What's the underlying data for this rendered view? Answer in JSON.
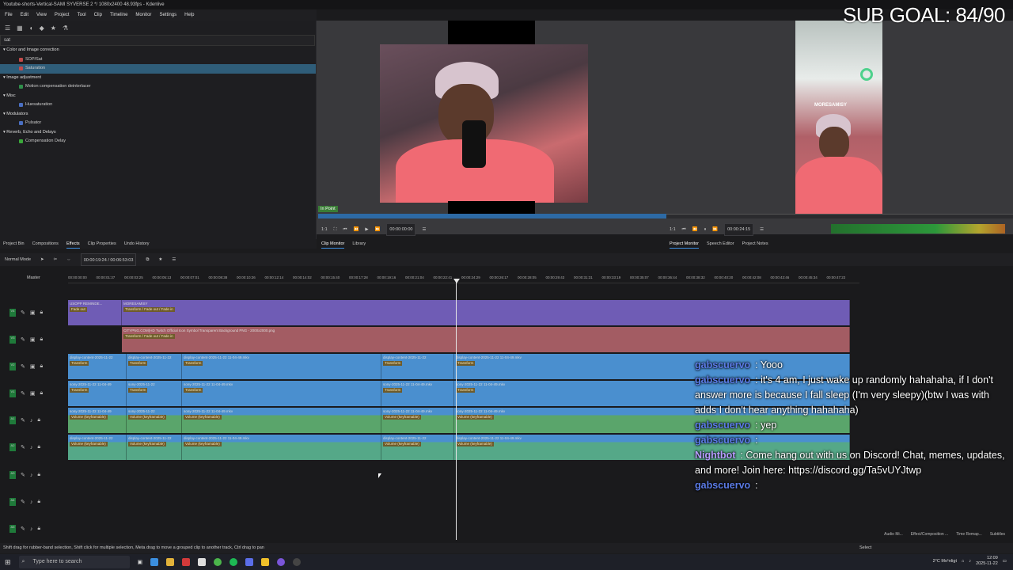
{
  "window": {
    "title": "Youtube-shorts-Vertical-SAMI SYVERSE 2 */ 1080x2400 48.93fps - Kdenlive"
  },
  "menu": [
    "File",
    "Edit",
    "View",
    "Project",
    "Tool",
    "Clip",
    "Timeline",
    "Monitor",
    "Settings",
    "Help"
  ],
  "effects": {
    "search_value": "sat",
    "tree": [
      {
        "kind": "cat",
        "label": "Color and Image correction"
      },
      {
        "kind": "item",
        "label": "SOP/Sat",
        "color": "#c24a4a",
        "selected": false
      },
      {
        "kind": "item",
        "label": "Saturation",
        "color": "#c24a4a",
        "selected": true
      },
      {
        "kind": "cat",
        "label": "Image adjustment"
      },
      {
        "kind": "item",
        "label": "Motion compensation deinterlacer",
        "color": "#2f8f4a",
        "selected": false
      },
      {
        "kind": "cat",
        "label": "Misc"
      },
      {
        "kind": "item",
        "label": "Huesaturation",
        "color": "#4a6fc2",
        "selected": false
      },
      {
        "kind": "cat",
        "label": "Modulators"
      },
      {
        "kind": "item",
        "label": "Pulsator",
        "color": "#4a6fc2",
        "selected": false
      },
      {
        "kind": "cat",
        "label": "Reverb, Echo and Delays"
      },
      {
        "kind": "item",
        "label": "Compensation Delay",
        "color": "#3aa83a",
        "selected": false
      }
    ]
  },
  "overlay": {
    "sub_goal": "SUB GOAL: 84/90"
  },
  "clip_monitor": {
    "in_point": "In Point",
    "zoom": "1:1",
    "timecode": "00:00:00:00"
  },
  "project_monitor": {
    "zoom": "1:1",
    "timecode": "00:00:24:15",
    "watermark": "MORESAMISY"
  },
  "tabs": {
    "left": [
      "Project Bin",
      "Compositions",
      "Effects",
      "Clip Properties",
      "Undo History"
    ],
    "left_active": "Effects",
    "clip": [
      "Clip Monitor",
      "Library"
    ],
    "clip_active": "Clip Monitor",
    "project": [
      "Project Monitor",
      "Speech Editor",
      "Project Notes"
    ],
    "project_active": "Project Monitor"
  },
  "timeline": {
    "mode": "Normal Mode",
    "position": "00:00:19:24 / 00:06:53:03",
    "master": "Master",
    "ruler": [
      "00:00:00:00",
      "00:00:01:37",
      "00:00:03:25",
      "00:00:05:13",
      "00:00:07:01",
      "00:00:08:38",
      "00:00:10:26",
      "00:00:12:14",
      "00:00:14:02",
      "00:00:15:40",
      "00:00:17:28",
      "00:00:19:16",
      "00:00:21:04",
      "00:00:22:41",
      "00:00:24:29",
      "00:00:26:17",
      "00:00:28:05",
      "00:00:29:43",
      "00:00:31:31",
      "00:00:33:19",
      "00:00:35:07",
      "00:00:36:44",
      "00:00:38:32",
      "00:00:40:20",
      "00:00:42:08",
      "00:00:43:46",
      "00:00:45:34",
      "00:00:47:22"
    ],
    "tracks": [
      {
        "id": "V4",
        "clips": [
          {
            "style": "purple",
            "title": "USOPP REMINDE...",
            "effect": "Fade out"
          },
          {
            "style": "purple",
            "title": "MORESAMISY",
            "effect": "Transform / Fade out / Fade in"
          }
        ]
      },
      {
        "id": "V3",
        "clips": [
          {
            "style": "pink",
            "title": "CITYPNG.COM)HD Twitch Official Icon Symbol Transparent Background PNG - 2000x2000.png",
            "effect": "Transform / Fade out / Fade in"
          }
        ]
      },
      {
        "id": "V2",
        "clips": [
          {
            "style": "blue",
            "title": "display-content-2025-11-22",
            "effect": "Transform"
          },
          {
            "style": "blue",
            "title": "display-content-2025-11-22",
            "effect": "Transform"
          },
          {
            "style": "blue",
            "title": "display-content-2025-11-22 11-04-49.mkv",
            "effect": "Transform"
          },
          {
            "style": "blue",
            "title": "display-content-2025-11-22",
            "effect": "Transform"
          },
          {
            "style": "blue",
            "title": "display-content-2025-11-22 11-04-49.mkv",
            "effect": "Transform"
          }
        ]
      },
      {
        "id": "V1",
        "clips": [
          {
            "style": "blue",
            "title": "sony-2025-11-22 11-04-49",
            "effect": "Transform"
          },
          {
            "style": "blue",
            "title": "sony-2025-11-22",
            "effect": "Transform"
          },
          {
            "style": "blue",
            "title": "sony-2025-11-22 11-04-49.mkv",
            "effect": "Transform"
          },
          {
            "style": "blue",
            "title": "sony-2025-11-22 11-04-49.mkv",
            "effect": "Transform"
          },
          {
            "style": "blue",
            "title": "sony-2025-11-22 11-04-49.mkv",
            "effect": "Transform"
          }
        ]
      },
      {
        "id": "A1",
        "clips": [
          {
            "style": "green",
            "title": "sony-2025-11-22 11-04-49",
            "effect": "Volume (keyframable)"
          },
          {
            "style": "green",
            "title": "sony-2025-11-22",
            "effect": "Volume (keyframable)"
          },
          {
            "style": "green",
            "title": "sony-2025-11-22 11-04-49.mkv",
            "effect": "Volume (keyframable)"
          },
          {
            "style": "green",
            "title": "sony-2025-11-22 11-04-49.mkv",
            "effect": "Volume (keyframable)"
          },
          {
            "style": "green",
            "title": "sony-2025-11-22 11-04-49.mkv",
            "effect": "Volume (keyframable)"
          }
        ]
      },
      {
        "id": "A2",
        "clips": [
          {
            "style": "teal",
            "title": "display-content-2025-11-22",
            "effect": "Volume (keyframable)"
          },
          {
            "style": "teal",
            "title": "display-content-2025-11-22",
            "effect": "Volume (keyframable)"
          },
          {
            "style": "teal",
            "title": "display-content-2025-11-22 11-04-49.mkv",
            "effect": "Volume (keyframable)"
          },
          {
            "style": "teal",
            "title": "display-content-2025-11-22",
            "effect": "Volume (keyframable)"
          },
          {
            "style": "teal",
            "title": "display-content-2025-11-22 11-04-49.mkv",
            "effect": "Volume (keyframable)"
          }
        ]
      },
      {
        "id": "A3",
        "clips": []
      },
      {
        "id": "A4",
        "clips": []
      },
      {
        "id": "A5",
        "clips": []
      }
    ]
  },
  "chat": [
    {
      "user": "gabscuervo",
      "text": "Yooo",
      "bot": false
    },
    {
      "user": "gabscuervo",
      "text": "it's 4 am, I just wake up randomly hahahaha, if I don't answer more is because I fall sleep (I'm very sleepy)(btw I was with adds I don't hear anything hahahaha)",
      "bot": false
    },
    {
      "user": "gabscuervo",
      "text": "yep",
      "bot": false
    },
    {
      "user": "gabscuervo",
      "text": "",
      "bot": false
    },
    {
      "user": "Nightbot",
      "text": "Come hang out with us on Discord! Chat, memes, updates, and more! Join here: https://discord.gg/Ta5vUYJtwp",
      "bot": true
    },
    {
      "user": "gabscuervo",
      "text": "",
      "bot": false
    }
  ],
  "status": {
    "hint": "Shift drag for rubber-band selection, Shift click for multiple selection, Meta drag to move a grouped clip to another track, Ctrl drag to pan",
    "select": "Select"
  },
  "bottom_tabs": [
    "Audio Mi...",
    "Effect/Composition ...",
    "Time Remap...",
    "Subtitles"
  ],
  "taskbar": {
    "search_placeholder": "Type here to search",
    "weather": "2°C Mo¹nligt",
    "time": "12:09",
    "date": "2025-11-22"
  }
}
